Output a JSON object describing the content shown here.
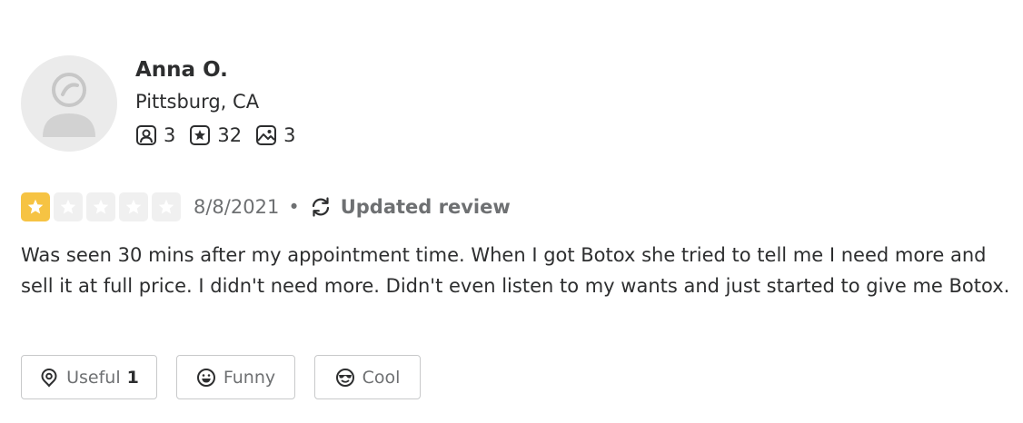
{
  "user": {
    "name": "Anna O.",
    "location": "Pittsburg, CA",
    "avatar_icon": "default-user-avatar",
    "stats": {
      "friends": "3",
      "reviews": "32",
      "photos": "3",
      "friends_icon": "friends-icon",
      "reviews_icon": "review-star-icon",
      "photos_icon": "photo-icon"
    }
  },
  "review": {
    "rating": 1,
    "max_rating": 5,
    "date": "8/8/2021",
    "separator": "•",
    "updated_label": "Updated review",
    "updated_icon": "refresh-icon",
    "text": "Was seen 30 mins after my appointment time. When I got Botox she tried to tell me I need more and sell it at full price. I didn't need more. Didn't even listen to my wants and just started to give me Botox."
  },
  "reactions": {
    "useful": {
      "label": "Useful",
      "count": "1",
      "icon": "lightbulb-icon"
    },
    "funny": {
      "label": "Funny",
      "icon": "smile-icon"
    },
    "cool": {
      "label": "Cool",
      "icon": "sunglasses-face-icon"
    }
  },
  "colors": {
    "star_filled": "#f6c343",
    "star_empty": "#f0f0f0",
    "text_primary": "#2d2e2f",
    "text_secondary": "#6e7072",
    "button_border": "#c8c9ca",
    "avatar_bg": "#ebebeb"
  }
}
